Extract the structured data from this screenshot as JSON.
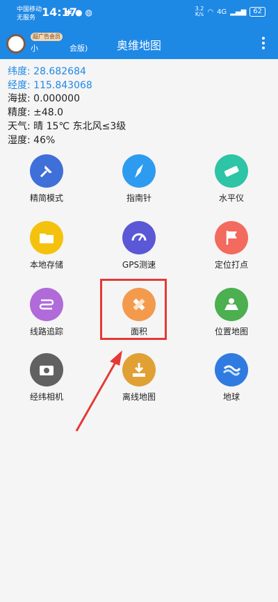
{
  "status_bar": {
    "carrier_line1": "中国移动",
    "carrier_line2": "无服务",
    "time": "14:17",
    "network_speed": "3.2",
    "speed_unit": "K/s",
    "signal_label": "4G",
    "battery": "62"
  },
  "app_bar": {
    "badge": "超广告会员",
    "user_name": "小",
    "edition": "会版)",
    "title": "奥维地图"
  },
  "info": {
    "latitude_label": "纬度:",
    "latitude_value": "28.682684",
    "longitude_label": "经度:",
    "longitude_value": "115.843068",
    "altitude_label": "海拔:",
    "altitude_value": "0.000000",
    "accuracy_label": "精度:",
    "accuracy_value": "±48.0",
    "weather_label": "天气:",
    "weather_value": "晴  15℃  东北风≤3级",
    "humidity_label": "湿度:",
    "humidity_value": "46%"
  },
  "tiles": [
    {
      "label": "精简模式",
      "color": "#3f6fd8"
    },
    {
      "label": "指南针",
      "color": "#2d9cf0"
    },
    {
      "label": "水平仪",
      "color": "#2ec4a6"
    },
    {
      "label": "本地存储",
      "color": "#f4c20d"
    },
    {
      "label": "GPS测速",
      "color": "#5a58d6"
    },
    {
      "label": "定位打点",
      "color": "#f26b5e"
    },
    {
      "label": "线路追踪",
      "color": "#b06ad9"
    },
    {
      "label": "面积",
      "color": "#f39a4d"
    },
    {
      "label": "位置地图",
      "color": "#4caf50"
    },
    {
      "label": "经纬相机",
      "color": "#616161"
    },
    {
      "label": "离线地图",
      "color": "#e0a034"
    },
    {
      "label": "地球",
      "color": "#2f7be0"
    }
  ],
  "colors": {
    "app_bar": "#1e88e5",
    "highlight": "#e53935"
  }
}
